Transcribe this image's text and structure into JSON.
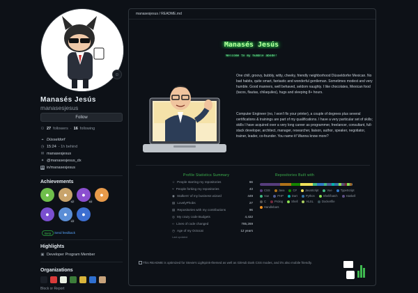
{
  "profile": {
    "name": "Manasés Jesús",
    "login": "manasesjesus",
    "follow_label": "Follow",
    "followers": "27",
    "followers_label": "followers",
    "following": "16",
    "following_label": "following",
    "location": "Düsseldorf",
    "local_time": "15:24",
    "time_ahead": "- 1h behind",
    "email": "manasesjesus",
    "twitter": "@manasesjesus_dx",
    "linkedin": "in/manasesjesus"
  },
  "achievements": {
    "heading": "Achievements",
    "badges": [
      {
        "icon": "pull-shark-icon",
        "color": "#6fbf4b",
        "count": ""
      },
      {
        "icon": "starstruck-icon",
        "color": "#c8a36b",
        "count": "x2"
      },
      {
        "icon": "galaxy-brain-icon",
        "color": "#8b4fcf",
        "count": "x4"
      },
      {
        "icon": "quickdraw-icon",
        "color": "#e89a4a",
        "count": ""
      },
      {
        "icon": "yolo-icon",
        "color": "#7a4fcf",
        "count": ""
      },
      {
        "icon": "pair-extraordinaire-icon",
        "color": "#5b8ed6",
        "count": "x3"
      },
      {
        "icon": "arctic-code-vault-icon",
        "color": "#3d6fd1",
        "count": ""
      }
    ],
    "beta_label": "Beta",
    "feedback_label": "Send feedback"
  },
  "highlights": {
    "heading": "Highlights",
    "item": "Developer Program Member"
  },
  "organizations": {
    "heading": "Organizations",
    "items": [
      {
        "icon": "org-1-icon",
        "color": "#1a1f27"
      },
      {
        "icon": "org-2-icon",
        "color": "#d93b3b"
      },
      {
        "icon": "org-3-icon",
        "color": "#e8f0e2"
      },
      {
        "icon": "org-4-icon",
        "color": "#3c7d3a"
      },
      {
        "icon": "org-5-icon",
        "color": "#d9b43b"
      },
      {
        "icon": "org-6-icon",
        "color": "#2f6fcf"
      },
      {
        "icon": "org-7-icon",
        "color": "#c7a37c"
      }
    ],
    "block_label": "Block or Report"
  },
  "readme": {
    "path": "manasesjesus / README.md",
    "title": "Manasés Jesús",
    "subtitle": "Welcome to my humble abode!",
    "para1": "One chill, groovy, bubbly, witty, cheeky, friendly neighborhood Düsseldorfer Mexican. No bad habits, quite smart, fantastic and wonderful gentleman. Sometimes modest and very humble. Good manners, well behaved, seldom naughty. I like chocolates, Mexican food (tacos, flautas, chilaquiles), hugs and sleeping 8+ hours.",
    "para2": "Computer Engineer (no, I won't fix your printer), a couple of degrees plus several certifications & trainings are part of my qualifications. I have a very particular set of skills; skills I have acquired over a very long career as programmer, freelancer, consultant, full-stack developer, architect, manager, researcher, liaison, author, speaker, negotiator, trainer, leader, co-founder. You name it! Wanna know more?"
  },
  "stats": {
    "title": "Profile Statistics Summary",
    "rows": [
      {
        "icon": "star-icon",
        "label": "People starring my repositories",
        "value": "66"
      },
      {
        "icon": "fork-icon",
        "label": "People forking my repositories",
        "value": "43"
      },
      {
        "icon": "eye-icon",
        "label": "Stalkers' of my business wizard",
        "value": "449"
      },
      {
        "icon": "repo-icon",
        "label": "LovelyPhobs",
        "value": "27"
      },
      {
        "icon": "repo-icon",
        "label": "Repositories with my contributions",
        "value": "96"
      },
      {
        "icon": "commit-icon",
        "label": "My crazy code Budgets",
        "value": "4,432"
      },
      {
        "icon": "code-icon",
        "label": "Lines of code changed",
        "value": "785,269"
      },
      {
        "icon": "clock-icon",
        "label": "Age of my Octocat",
        "value": "12 years"
      }
    ],
    "footer": "Last updated"
  },
  "languages": {
    "title": "Repositories Built with",
    "items": [
      {
        "name": "CSS",
        "color": "#563d7c",
        "share": 0.22
      },
      {
        "name": "Java",
        "color": "#b07219",
        "share": 0.12
      },
      {
        "name": "C#",
        "color": "#178600",
        "share": 0.1
      },
      {
        "name": "JavaScript",
        "color": "#f1e05a",
        "share": 0.14
      },
      {
        "name": "Vue",
        "color": "#41b883",
        "share": 0.04
      },
      {
        "name": "TypeScript",
        "color": "#3178c6",
        "share": 0.08
      },
      {
        "name": "Vue",
        "color": "#41b883",
        "share": 0.03
      },
      {
        "name": "PHP",
        "color": "#4F5D95",
        "share": 0.05
      },
      {
        "name": "Dart",
        "color": "#00B4AB",
        "share": 0.03
      },
      {
        "name": "Python",
        "color": "#3572A5",
        "share": 0.05
      },
      {
        "name": "Shell/batch",
        "color": "#89e051",
        "share": 0.03
      },
      {
        "name": "Haskell",
        "color": "#5e5086",
        "share": 0.02
      },
      {
        "name": "C",
        "color": "#555555",
        "share": 0.02
      },
      {
        "name": "Prolog",
        "color": "#74283c",
        "share": 0.02
      },
      {
        "name": "Shell",
        "color": "#89e051",
        "share": 0.02
      },
      {
        "name": "HLSL",
        "color": "#aace60",
        "share": 0.01
      },
      {
        "name": "Dockerfile",
        "color": "#384d54",
        "share": 0.01
      },
      {
        "name": "Handlebars",
        "color": "#f7931e",
        "share": 0.005
      },
      {
        "name": "Assembly",
        "color": "#6E4C13",
        "share": 0.005
      },
      {
        "name": "Ruby",
        "color": "#701516",
        "share": 0.005
      },
      {
        "name": "Hack",
        "color": "#878787",
        "share": 0.005
      }
    ]
  },
  "footer": {
    "broken_image": "This README is optimized for Stevie's Lightpink-themed as well as GitHub Dark CSS modes, and it's also mobile friendly."
  },
  "colors": {
    "accent_green": "#3fb950",
    "link_blue": "#58a6ff",
    "neon": "#b6ff9c"
  }
}
